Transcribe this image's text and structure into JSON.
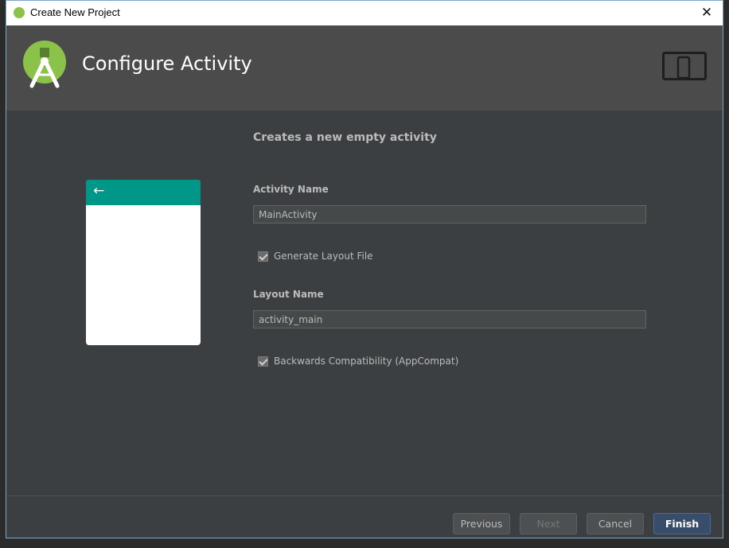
{
  "window": {
    "title": "Create New Project",
    "close_label": "✕"
  },
  "banner": {
    "heading": "Configure Activity"
  },
  "main": {
    "subtitle": "Creates a new empty activity",
    "activity_name": {
      "label": "Activity Name",
      "value": "MainActivity"
    },
    "generate_layout": {
      "label": "Generate Layout File",
      "checked": true
    },
    "layout_name": {
      "label": "Layout Name",
      "value": "activity_main"
    },
    "backwards_compat": {
      "label": "Backwards Compatibility (AppCompat)",
      "checked": true
    }
  },
  "preview": {
    "back_arrow": "←"
  },
  "footer": {
    "previous_label": "Previous",
    "next_label": "Next",
    "cancel_label": "Cancel",
    "finish_label": "Finish"
  },
  "colors": {
    "accent": "#009688",
    "banner_bg": "#4b4b4b",
    "dialog_bg": "#3c3f41",
    "primary_button": "#384d6c",
    "logo_green": "#8bc34a"
  }
}
